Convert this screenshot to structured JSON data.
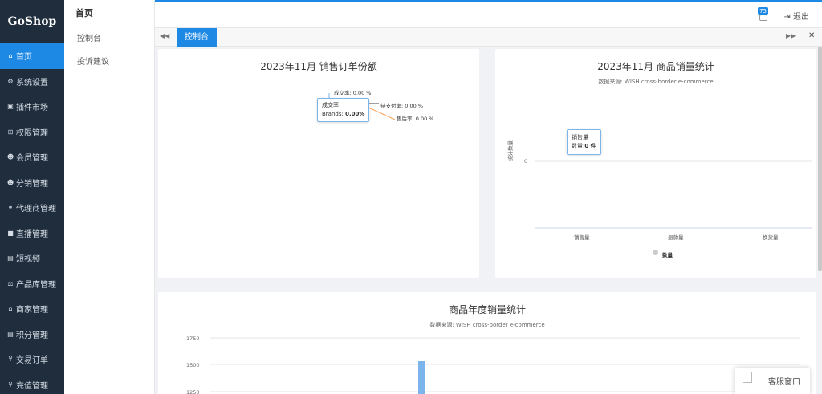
{
  "app": {
    "logo": "GoShop"
  },
  "sidebar": {
    "items": [
      {
        "label": "首页",
        "icon": "home-icon",
        "glyph": "⌂",
        "active": true
      },
      {
        "label": "系统设置",
        "icon": "gear-icon",
        "glyph": "⚙"
      },
      {
        "label": "插件市场",
        "icon": "plugin-icon",
        "glyph": "▣"
      },
      {
        "label": "权限管理",
        "icon": "sitemap-icon",
        "glyph": "⊞"
      },
      {
        "label": "会员管理",
        "icon": "users-icon",
        "glyph": "☻"
      },
      {
        "label": "分销管理",
        "icon": "users-icon",
        "glyph": "☻"
      },
      {
        "label": "代理商管理",
        "icon": "agent-icon",
        "glyph": "⚭"
      },
      {
        "label": "直播管理",
        "icon": "video-icon",
        "glyph": "■"
      },
      {
        "label": "短视频",
        "icon": "file-icon",
        "glyph": "▤"
      },
      {
        "label": "产品库管理",
        "icon": "balance-icon",
        "glyph": "⚖"
      },
      {
        "label": "商家管理",
        "icon": "bank-icon",
        "glyph": "⌂"
      },
      {
        "label": "积分管理",
        "icon": "file-icon",
        "glyph": "▤"
      },
      {
        "label": "交易订单",
        "icon": "rmb-icon",
        "glyph": "¥"
      },
      {
        "label": "充值管理",
        "icon": "yen-icon",
        "glyph": "¥"
      }
    ]
  },
  "subnav": {
    "header": "首页",
    "items": [
      "控制台",
      "投诉建议"
    ]
  },
  "topbar": {
    "badge": "75",
    "logout": "退出"
  },
  "tabs": {
    "active": "控制台"
  },
  "pie_card": {
    "title": "2023年11月 销售订单份额",
    "label1": "成交率: 0.00 %",
    "label2": "待支付率: 0.00 %",
    "label3": "售后率: 0.00 %",
    "tooltip_title": "成交率",
    "tooltip_series": "Brands: ",
    "tooltip_value": "0.00%"
  },
  "chart_data": [
    {
      "type": "pie",
      "title": "2023年11月 销售订单份额",
      "series": [
        {
          "name": "Brands",
          "values": [
            0,
            0,
            0
          ]
        }
      ],
      "categories": [
        "成交率",
        "待支付率",
        "售后率"
      ]
    },
    {
      "type": "bar",
      "title": "2023年11月 商品销量统计",
      "subtitle": "数据来源: WISH cross-border e-commerce",
      "ylabel": "统计数量",
      "categories": [
        "销售量",
        "退款量",
        "换货量"
      ],
      "series": [
        {
          "name": "数量",
          "values": [
            0,
            0,
            0
          ]
        }
      ],
      "yticks": [
        "0"
      ],
      "legend": "bottom"
    },
    {
      "type": "bar",
      "title": "商品年度销量统计",
      "subtitle": "数据来源: WISH cross-border e-commerce",
      "yticks": [
        "1750",
        "1500",
        "1250"
      ]
    }
  ],
  "bar_card": {
    "title": "2023年11月 商品销量统计",
    "subtitle": "数据来源: WISH cross-border e-commerce",
    "ylabel": "统计数量",
    "ytick": "0",
    "categories": [
      "销售量",
      "退款量",
      "换货量"
    ],
    "legend": "数量",
    "tooltip_title": "销售量",
    "tooltip_line": "数量:",
    "tooltip_value": "0 件"
  },
  "year_card": {
    "title": "商品年度销量统计",
    "subtitle": "数据来源: WISH cross-border e-commerce",
    "yticks": [
      "1750",
      "1500",
      "1250"
    ]
  },
  "kefu": {
    "label": "客服窗口"
  },
  "colors": {
    "accent": "#1e88e5",
    "sidebar": "#1f2d3d",
    "bar": "#7cb5ec"
  }
}
